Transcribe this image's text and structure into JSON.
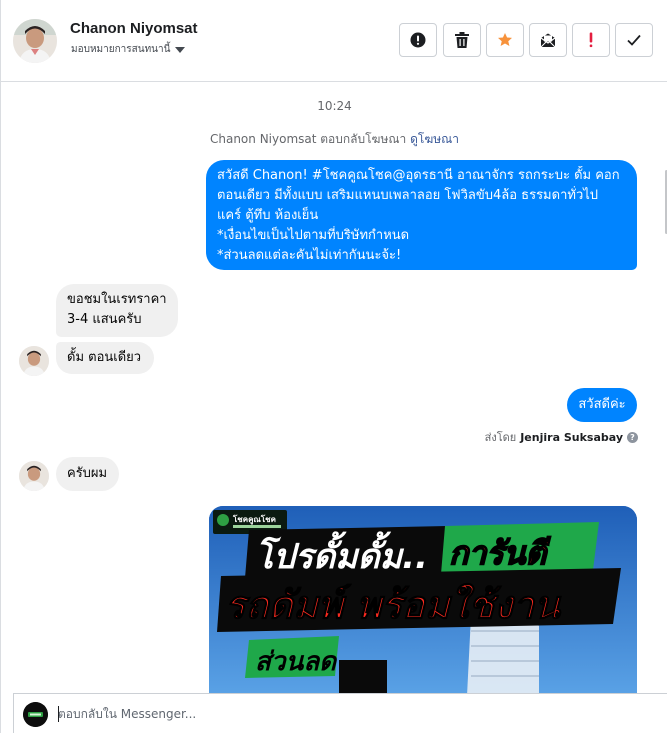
{
  "header": {
    "name": "Chanon Niyomsat",
    "assign_label": "มอบหมายการสนทนานี้",
    "toolbar": [
      {
        "icon": "alert-circle-icon",
        "action": "mark-spam"
      },
      {
        "icon": "trash-icon",
        "action": "delete"
      },
      {
        "icon": "star-icon",
        "action": "star"
      },
      {
        "icon": "mark-unread-icon",
        "action": "mark-unread"
      },
      {
        "icon": "exclamation-icon",
        "action": "follow-up"
      },
      {
        "icon": "check-icon",
        "action": "mark-done"
      }
    ]
  },
  "thread": {
    "timestamp": "10:24",
    "ad_reply": {
      "prefix": "Chanon Niyomsat ตอบกลับโฆษณา",
      "link": "ดูโฆษณา"
    },
    "messages": [
      {
        "direction": "outgoing",
        "lines": [
          "สวัสดี Chanon! #โชคคูณโชค@อุดรธานี อาณาจักร รถกระบะ ดั้ม คอก",
          "ตอนเดียว มีทั้งแบบ เสริมแหนบเพลาลอย โฟวิลขับ4ล้อ ธรรมดาทั่วไป",
          "แคร์ ตู้ทึบ ห้องเย็น",
          "*เงื่อนไขเป็นไปตามที่บริษัทกำหนด",
          "*ส่วนลดแต่ละคันไม่เท่ากันนะจ้ะ!"
        ]
      },
      {
        "direction": "incoming",
        "lines": [
          "ขอชมในเรทราคา",
          "3-4 แสนครับ"
        ]
      },
      {
        "direction": "incoming",
        "text": "ดั้ม ตอนเดียว"
      },
      {
        "direction": "outgoing",
        "text": "สวัสดีค่ะ",
        "sent_by_label": "ส่งโดย",
        "sent_by_name": "Jenjira Suksabay"
      },
      {
        "direction": "incoming",
        "text": "ครับผม"
      }
    ],
    "promo_image": {
      "logo_text": "โชคคูณโชค",
      "line1_a": "โปรดั้มดั้ม..",
      "line1_b": "การันตี",
      "line2": "รถดัมพ์ พร้อมใช้งาน",
      "line3": "ส่วนลด"
    }
  },
  "composer": {
    "placeholder": "ตอบกลับใน Messenger..."
  },
  "colors": {
    "brand_blue": "#0084ff",
    "incoming_bubble": "#f0f0f0",
    "star": "#f7923b",
    "alert_red": "#e41e3f"
  }
}
